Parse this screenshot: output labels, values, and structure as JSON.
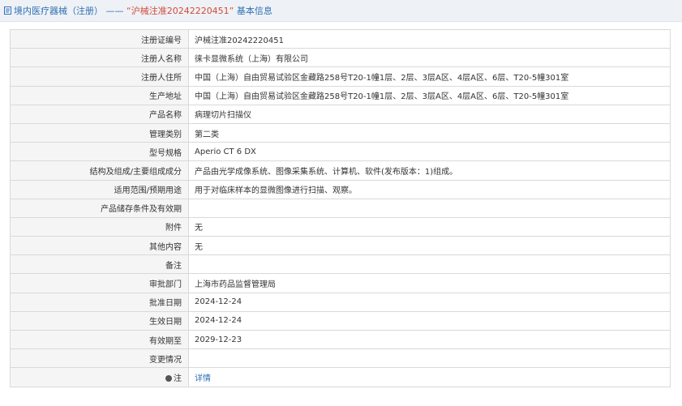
{
  "header": {
    "icon": "document-icon",
    "prefix": "境内医疗器械（注册） —— ",
    "quoted": "“沪械注准20242220451”",
    "suffix": " 基本信息"
  },
  "rows": [
    {
      "label": "注册证编号",
      "value": "沪械注准20242220451"
    },
    {
      "label": "注册人名称",
      "value": "徕卡显微系统（上海）有限公司"
    },
    {
      "label": "注册人住所",
      "value": "中国（上海）自由贸易试验区金藏路258号T20-1幢1层、2层、3层A区、4层A区、6层、T20-5幢301室"
    },
    {
      "label": "生产地址",
      "value": "中国（上海）自由贸易试验区金藏路258号T20-1幢1层、2层、3层A区、4层A区、6层、T20-5幢301室"
    },
    {
      "label": "产品名称",
      "value": "病理切片扫描仪"
    },
    {
      "label": "管理类别",
      "value": "第二类"
    },
    {
      "label": "型号规格",
      "value": "Aperio CT 6 DX"
    },
    {
      "label": "结构及组成/主要组成成分",
      "value": "产品由光学成像系统、图像采集系统、计算机、软件(发布版本：1)组成。"
    },
    {
      "label": "适用范围/预期用途",
      "value": "用于对临床样本的显微图像进行扫描、观察。"
    },
    {
      "label": "产品储存条件及有效期",
      "value": ""
    },
    {
      "label": "附件",
      "value": "无"
    },
    {
      "label": "其他内容",
      "value": "无"
    },
    {
      "label": "备注",
      "value": ""
    },
    {
      "label": "审批部门",
      "value": "上海市药品监督管理局"
    },
    {
      "label": "批准日期",
      "value": "2024-12-24"
    },
    {
      "label": "生效日期",
      "value": "2024-12-24"
    },
    {
      "label": "有效期至",
      "value": "2029-12-23"
    },
    {
      "label": "变更情况",
      "value": ""
    }
  ],
  "note": {
    "icon": "bullet-icon",
    "label": "注",
    "link": "详情"
  }
}
